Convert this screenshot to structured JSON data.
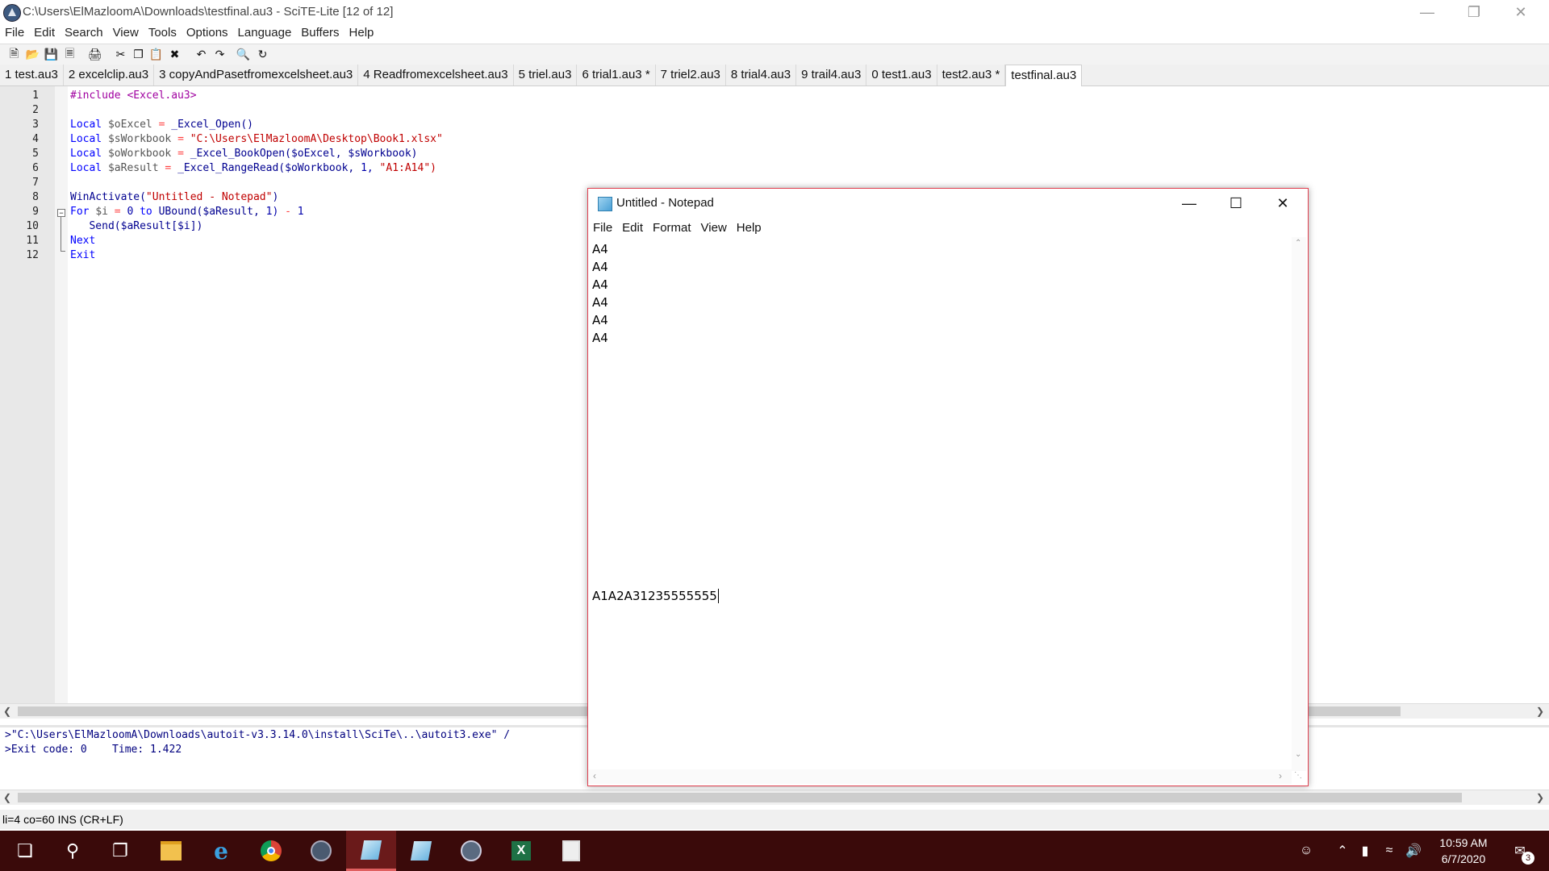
{
  "scite": {
    "title": "C:\\Users\\ElMazloomA\\Downloads\\testfinal.au3 - SciTE-Lite [12 of 12]",
    "menu": [
      "File",
      "Edit",
      "Search",
      "View",
      "Tools",
      "Options",
      "Language",
      "Buffers",
      "Help"
    ],
    "tabs": [
      "1 test.au3",
      "2 excelclip.au3",
      "3 copyAndPasetfromexcelsheet.au3",
      "4 Readfromexcelsheet.au3",
      "5 triel.au3",
      "6 trial1.au3 *",
      "7 triel2.au3",
      "8 trial4.au3",
      "9 trail4.au3",
      "0 test1.au3",
      "test2.au3 *",
      "testfinal.au3"
    ],
    "active_tab": "testfinal.au3",
    "line_numbers": [
      "1",
      "2",
      "3",
      "4",
      "5",
      "6",
      "7",
      "8",
      "9",
      "10",
      "11",
      "12"
    ],
    "code": {
      "l1": "#include <Excel.au3>",
      "l3a": "Local",
      "l3b": "$oExcel",
      "l3c": "=",
      "l3d": "_Excel_Open()",
      "l4a": "Local",
      "l4b": "$sWorkbook",
      "l4c": "=",
      "l4d": "\"C:\\Users\\ElMazloomA\\Desktop\\Book1.xlsx\"",
      "l5a": "Local",
      "l5b": "$oWorkbook",
      "l5c": "=",
      "l5d": "_Excel_BookOpen($oExcel, $sWorkbook)",
      "l6a": "Local",
      "l6b": "$aResult",
      "l6c": "=",
      "l6d": "_Excel_RangeRead($oWorkbook,",
      "l6e": "1,",
      "l6f": "\"A1:A14\")",
      "l8a": "WinActivate(",
      "l8b": "\"Untitled - Notepad\"",
      "l8c": ")",
      "l9a": "For",
      "l9b": "$i",
      "l9c": "=",
      "l9d": "0",
      "l9e": "to",
      "l9f": "UBound($aResult,",
      "l9g": "1)",
      "l9h": "-",
      "l9i": "1",
      "l10": "Send($aResult[$i])",
      "l11": "Next",
      "l12": "Exit"
    },
    "output": [
      ">\"C:\\Users\\ElMazloomA\\Downloads\\autoit-v3.3.14.0\\install\\SciTe\\..\\autoit3.exe\" /",
      ">Exit code: 0    Time: 1.422"
    ],
    "status": "li=4 co=60 INS (CR+LF)"
  },
  "notepad": {
    "title": "Untitled - Notepad",
    "menu": [
      "File",
      "Edit",
      "Format",
      "View",
      "Help"
    ],
    "lines": [
      "A4",
      "A4",
      "A4",
      "A4",
      "A4",
      "A4"
    ],
    "last_line": "A1A2A31235555555"
  },
  "taskbar": {
    "time": "10:59 AM",
    "date": "6/7/2020",
    "notifications": "3"
  }
}
